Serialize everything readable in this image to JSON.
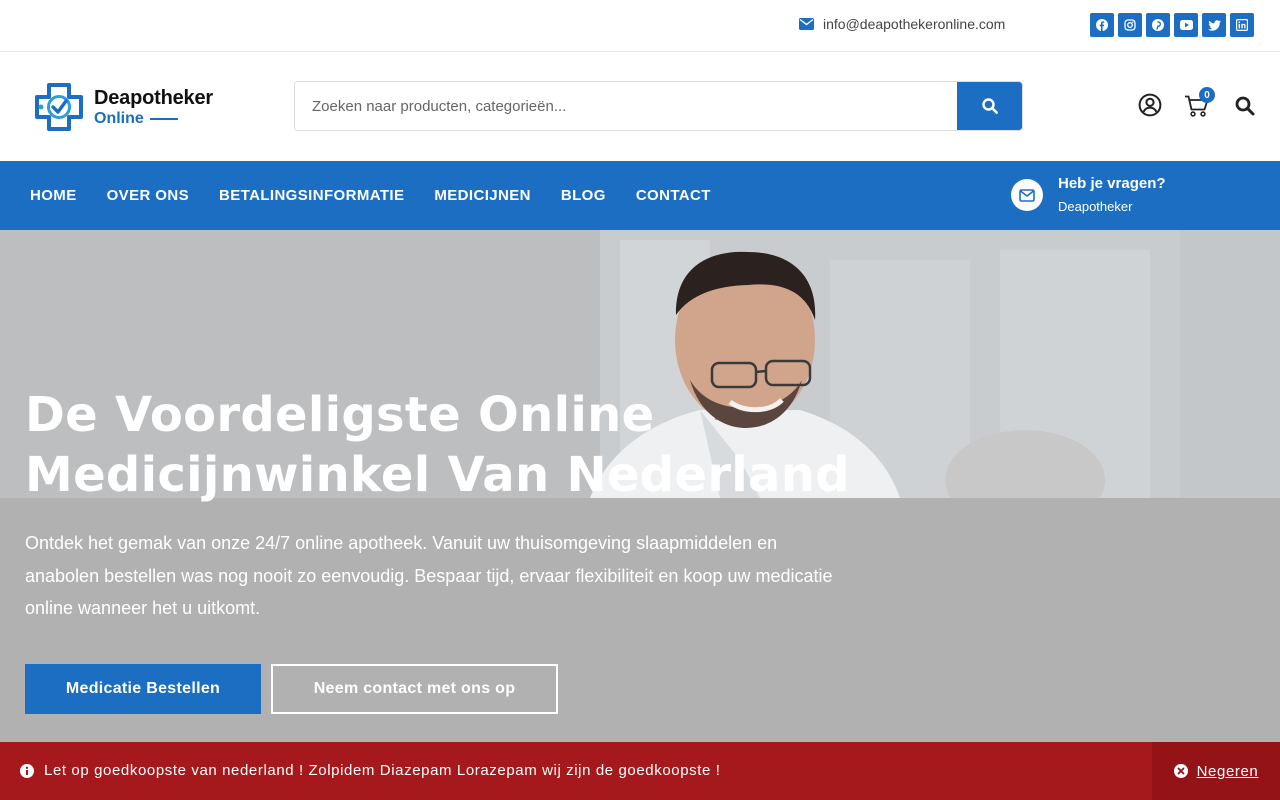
{
  "topbar": {
    "email": "info@deapothekeronline.com",
    "social_icons": [
      "facebook-icon",
      "instagram-icon",
      "pinterest-icon",
      "youtube-icon",
      "twitter-icon",
      "linkedin-icon"
    ]
  },
  "header": {
    "logo_line1": "Deapotheker",
    "logo_line2": "Online",
    "search_placeholder": "Zoeken naar producten, categorieën...",
    "cart_count": "0"
  },
  "nav": {
    "items": [
      "HOME",
      "OVER ONS",
      "BETALINGSINFORMATIE",
      "MEDICIJNEN",
      "BLOG",
      "CONTACT"
    ],
    "question_title": "Heb je vragen?",
    "question_sub": "Deapotheker"
  },
  "hero": {
    "title_line1": "De Voordeligste Online",
    "title_line2": "Medicijnwinkel Van Nederland",
    "description": "Ontdek het gemak van onze 24/7 online apotheek. Vanuit uw thuisomgeving slaapmiddelen en anabolen bestellen was nog nooit zo eenvoudig. Bespaar tijd, ervaar flexibiliteit en koop uw medicatie online wanneer het u uitkomt.",
    "primary_button": "Medicatie Bestellen",
    "secondary_button": "Neem contact met ons op"
  },
  "notice": {
    "message": "Let op goedkoopste van nederland ! Zolpidem Diazepam Lorazepam wij zijn de goedkoopste !",
    "dismiss": "Negeren"
  },
  "colors": {
    "brand_blue": "#1b6ec2",
    "notice_red": "#a5181b"
  }
}
